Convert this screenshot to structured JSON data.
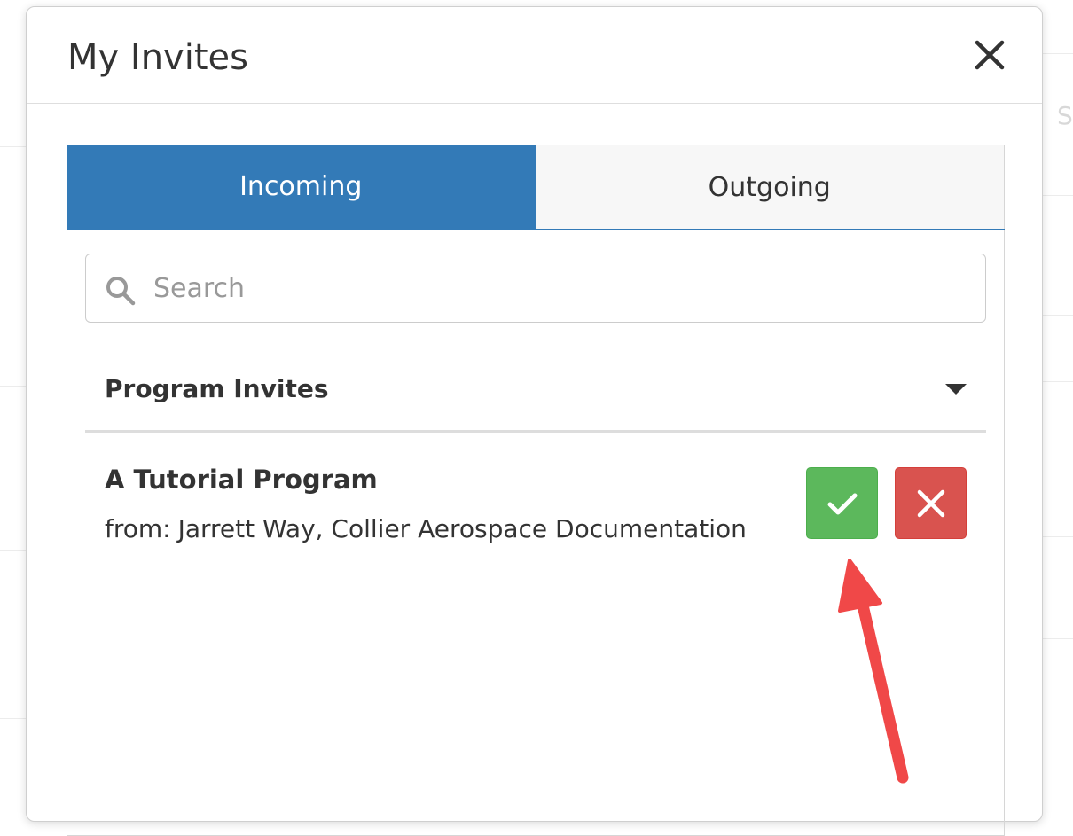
{
  "background": {
    "partial_text": "S"
  },
  "modal": {
    "title": "My Invites",
    "close_icon": "close-icon"
  },
  "tabs": [
    {
      "label": "Incoming",
      "active": true
    },
    {
      "label": "Outgoing",
      "active": false
    }
  ],
  "search": {
    "placeholder": "Search",
    "value": "",
    "icon": "search-icon"
  },
  "section": {
    "title": "Program Invites",
    "icon": "caret-down-icon"
  },
  "invites": [
    {
      "title": "A Tutorial Program",
      "from_label": "from:",
      "from_value": "Jarrett Way, Collier Aerospace Documentation",
      "accept_icon": "check-icon",
      "decline_icon": "x-icon"
    }
  ],
  "colors": {
    "tab_active": "#337ab7",
    "accept": "#5cb85c",
    "decline": "#d9534f",
    "annotation_arrow": "#f04848"
  }
}
